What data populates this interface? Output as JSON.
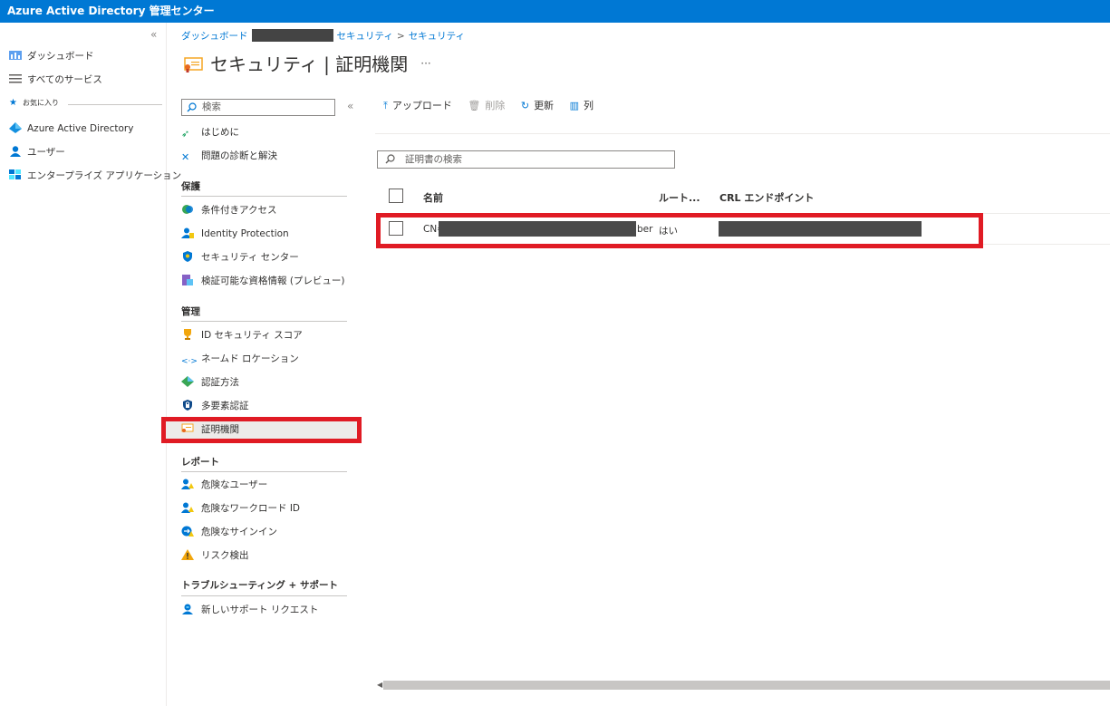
{
  "app": {
    "title": "Azure Active Directory 管理センター"
  },
  "leftnav": {
    "collapse_glyph": "«",
    "items": [
      {
        "label": "ダッシュボード",
        "icon": "dashboard-icon"
      },
      {
        "label": "すべてのサービス",
        "icon": "list-icon"
      },
      {
        "label": "お気に入り",
        "icon": "star-icon"
      },
      {
        "label": "Azure Active Directory",
        "icon": "aad-icon"
      },
      {
        "label": "ユーザー",
        "icon": "user-icon"
      },
      {
        "label": "エンタープライズ アプリケーション",
        "icon": "apps-icon"
      }
    ]
  },
  "breadcrumb": {
    "first": "ダッシュボード",
    "second": "セキュリティ",
    "sep": ">",
    "third": "セキュリティ"
  },
  "page": {
    "title": "セキュリティ | 証明機関",
    "more": "···"
  },
  "sidemenu": {
    "search_placeholder": "検索",
    "collapse_glyph": "«",
    "top": [
      {
        "label": "はじめに",
        "icon": "rocket-icon"
      },
      {
        "label": "問題の診断と解決",
        "icon": "wrench-icon"
      }
    ],
    "sections": [
      {
        "title": "保護",
        "items": [
          {
            "label": "条件付きアクセス",
            "icon": "conditional-access-icon"
          },
          {
            "label": "Identity Protection",
            "icon": "identity-protection-icon"
          },
          {
            "label": "セキュリティ センター",
            "icon": "shield-icon"
          },
          {
            "label": "検証可能な資格情報 (プレビュー)",
            "icon": "credential-icon"
          }
        ]
      },
      {
        "title": "管理",
        "items": [
          {
            "label": "ID セキュリティ スコア",
            "icon": "trophy-icon"
          },
          {
            "label": "ネームド ロケーション",
            "icon": "named-location-icon"
          },
          {
            "label": "認証方法",
            "icon": "auth-method-icon"
          },
          {
            "label": "多要素認証",
            "icon": "mfa-icon"
          },
          {
            "label": "証明機関",
            "icon": "certificate-icon"
          }
        ]
      },
      {
        "title": "レポート",
        "items": [
          {
            "label": "危険なユーザー",
            "icon": "risky-user-icon"
          },
          {
            "label": "危険なワークロード ID",
            "icon": "risky-workload-icon"
          },
          {
            "label": "危険なサインイン",
            "icon": "risky-signin-icon"
          },
          {
            "label": "リスク検出",
            "icon": "warning-icon"
          }
        ]
      },
      {
        "title": "トラブルシューティング + サポート",
        "items": [
          {
            "label": "新しいサポート リクエスト",
            "icon": "support-icon"
          }
        ]
      }
    ]
  },
  "toolbar": {
    "upload": "アップロード",
    "delete": "削除",
    "refresh": "更新",
    "columns": "列"
  },
  "cert_search": {
    "placeholder": "証明書の検索"
  },
  "table": {
    "headers": {
      "name": "名前",
      "root": "ルート...",
      "crl": "CRL エンドポイント"
    },
    "rows": [
      {
        "name_prefix": "CN=",
        "name_suffix": "ber",
        "root": "はい"
      }
    ]
  },
  "colors": {
    "accent": "#0078d4",
    "highlight": "#e01b24"
  }
}
